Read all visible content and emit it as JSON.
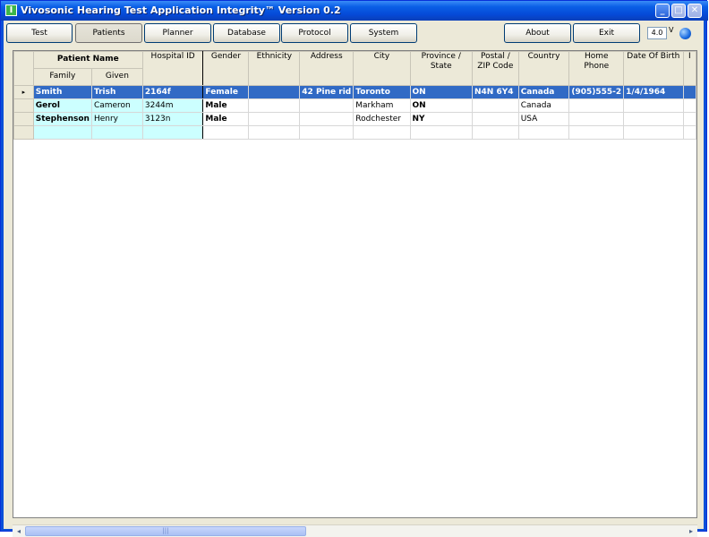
{
  "window": {
    "title": "Vivosonic Hearing Test Application Integrity™ Version 0.2",
    "app_icon": "I",
    "controls": {
      "minimize": "_",
      "maximize": "□",
      "close": "✕"
    }
  },
  "toolbar": {
    "buttons": [
      "Test",
      "Patients",
      "Planner",
      "Database",
      "Protocol",
      "System"
    ],
    "right_buttons": [
      "About",
      "Exit"
    ],
    "active": "Patients",
    "voltage_value": "4.0",
    "voltage_unit": "V"
  },
  "grid": {
    "group_header": "Patient Name",
    "name_sub_headers": [
      "Family",
      "Given"
    ],
    "column_headers": [
      "Hospital ID",
      "Gender",
      "Ethnicity",
      "Address",
      "City",
      "Province / State",
      "Postal / ZIP Code",
      "Country",
      "Home Phone",
      "Date Of Birth",
      "I"
    ],
    "row_indicator": "▸",
    "rows": [
      [
        "Smith",
        "Trish",
        "2164f",
        "Female",
        "",
        "42 Pine rid",
        "Toronto",
        "ON",
        "N4N 6Y4",
        "Canada",
        "(905)555-2",
        "1/4/1964",
        ""
      ],
      [
        "Gerol",
        "Cameron",
        "3244m",
        "Male",
        "",
        "",
        "Markham",
        "ON",
        "",
        "Canada",
        "",
        "",
        ""
      ],
      [
        "Stephenson",
        "Henry",
        "3123n",
        "Male",
        "",
        "",
        "Rodchester",
        "NY",
        "",
        "USA",
        "",
        "",
        ""
      ],
      [
        "",
        "",
        "",
        "",
        "",
        "",
        "",
        "",
        "",
        "",
        "",
        "",
        ""
      ]
    ],
    "selected_row": 0
  },
  "scrollbar": {
    "left_arrow": "◂",
    "right_arrow": "▸",
    "thumb_grip": "|||"
  },
  "colors": {
    "selection": "#316ac5",
    "frozen_cell": "#ccffff",
    "title_blue": "#0549d7"
  }
}
